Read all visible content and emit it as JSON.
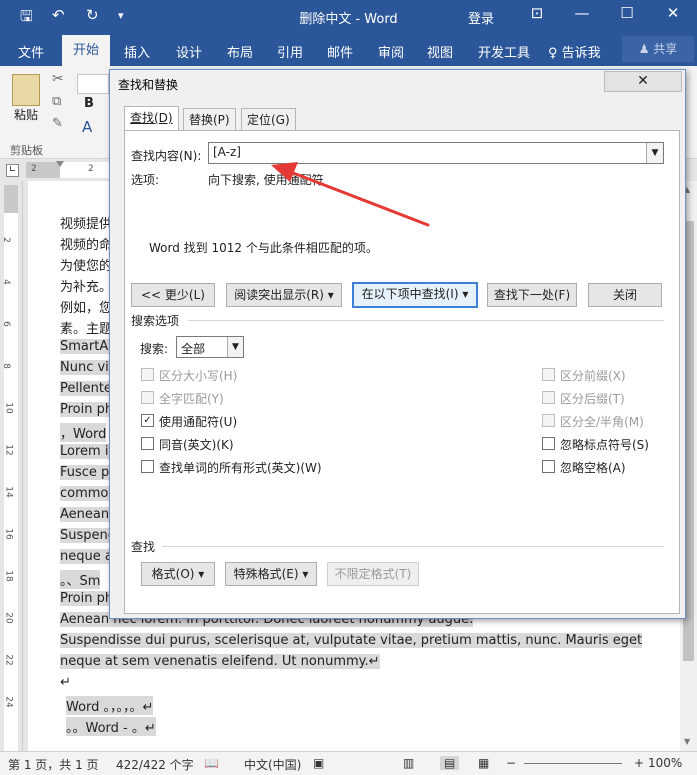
{
  "titlebar": {
    "title": "删除中文 - Word",
    "login": "登录",
    "icons": [
      "save-icon",
      "undo-icon",
      "redo-icon",
      "customize-icon",
      "ribbon-display-icon",
      "minimize-icon",
      "maximize-icon",
      "close-icon"
    ]
  },
  "tabs": {
    "file": "文件",
    "home": "开始",
    "insert": "插入",
    "design": "设计",
    "layout": "布局",
    "references": "引用",
    "mailings": "邮件",
    "review": "审阅",
    "view": "视图",
    "developer": "开发工具",
    "tellme": "告诉我",
    "share": "共享"
  },
  "ribbon": {
    "paste": "粘贴",
    "clipboard": "剪贴板",
    "bold": "B"
  },
  "ruler": {
    "left": "2",
    "right": "2"
  },
  "vruler": [
    "2",
    "4",
    "6",
    "8",
    "10",
    "12",
    "14",
    "16",
    "18",
    "20",
    "22",
    "24"
  ],
  "document": {
    "lines": [
      "视频提供",
      "视频的命",
      "为使您的",
      "为补充。",
      "例如，您",
      "素。主题",
      "SmartAr",
      "Nunc viv",
      "Pellente",
      "Proin ph",
      "，Word",
      "Lorem ip",
      "Fusce p",
      "commod",
      "Aenean",
      "Suspend",
      "neque a",
      "。、Sm",
      "Proin ph",
      "Aenean nec lorem. In porttitor. Donec laoreet nonummy augue.",
      "Suspendisse  dui  purus,  scelerisque  at,  vulputate  vitae,  pretium  mattis,  nunc.  Mauris  eget",
      "neque at sem venenatis eleifend. Ut nonummy.↵",
      "↵",
      "Word  。，。，。↵",
      "。。Word  -  。↵"
    ]
  },
  "dialog": {
    "title": "查找和替换",
    "close": "✕",
    "tabs": {
      "find": "查找(D)",
      "replace": "替换(P)",
      "goto": "定位(G)"
    },
    "find_label": "查找内容(N):",
    "find_value": "[A-z]",
    "options_label": "选项:",
    "options_value": "向下搜索, 使用通配符",
    "result_message": "Word 找到 1012 个与此条件相匹配的项。",
    "buttons": {
      "less": "<< 更少(L)",
      "reading_highlight": "阅读突出显示(R)",
      "find_in": "在以下项中查找(I)",
      "find_next": "查找下一处(F)",
      "close": "关闭"
    },
    "search_options_title": "搜索选项",
    "search_label": "搜索:",
    "search_value": "全部",
    "checkboxes_left": [
      {
        "label": "区分大小写(H)",
        "checked": false,
        "enabled": false
      },
      {
        "label": "全字匹配(Y)",
        "checked": false,
        "enabled": false
      },
      {
        "label": "使用通配符(U)",
        "checked": true,
        "enabled": true
      },
      {
        "label": "同音(英文)(K)",
        "checked": false,
        "enabled": true
      },
      {
        "label": "查找单词的所有形式(英文)(W)",
        "checked": false,
        "enabled": true
      }
    ],
    "checkboxes_right": [
      {
        "label": "区分前缀(X)",
        "checked": false,
        "enabled": false
      },
      {
        "label": "区分后缀(T)",
        "checked": false,
        "enabled": false
      },
      {
        "label": "区分全/半角(M)",
        "checked": false,
        "enabled": false
      },
      {
        "label": "忽略标点符号(S)",
        "checked": false,
        "enabled": true
      },
      {
        "label": "忽略空格(A)",
        "checked": false,
        "enabled": true
      }
    ],
    "find_section_title": "查找",
    "format_buttons": {
      "format": "格式(O)",
      "special": "特殊格式(E)",
      "no_format": "不限定格式(T)"
    }
  },
  "status": {
    "page": "第 1 页，共 1 页",
    "words": "422/422 个字",
    "language": "中文(中国)",
    "zoom": "100%"
  },
  "colors": {
    "accent": "#2b579a",
    "arrow": "#e53935",
    "focus": "#3c7fd5"
  }
}
